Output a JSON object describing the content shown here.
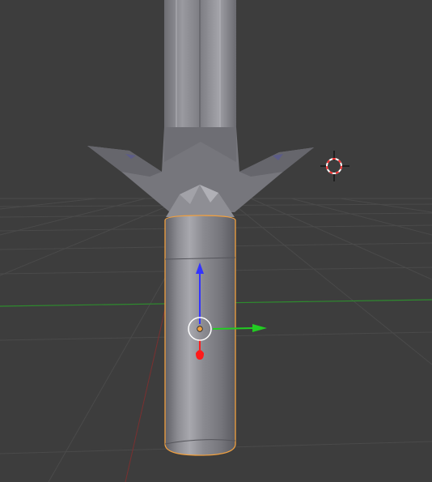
{
  "viewport": {
    "mode": "3d-viewport",
    "background_color": "#3d3d3d",
    "grid_color": "#4a4a4a",
    "x_axis_color": "#2e8b2e",
    "y_axis_color": "#7a3030"
  },
  "scene": {
    "selected_object": "handle-cylinder",
    "selection_outline_color": "#f0a040",
    "mesh_color": "#8a8a90"
  },
  "gizmo": {
    "type": "translate",
    "x_handle_color": "#22cc22",
    "z_handle_color": "#3333ff",
    "y_handle_color": "#ff1a1a",
    "pivot_color": "#f0a040"
  },
  "cursor_3d": {
    "icon": "3d-cursor-icon",
    "ring_color_a": "#ff3030",
    "ring_color_b": "#ffffff"
  }
}
